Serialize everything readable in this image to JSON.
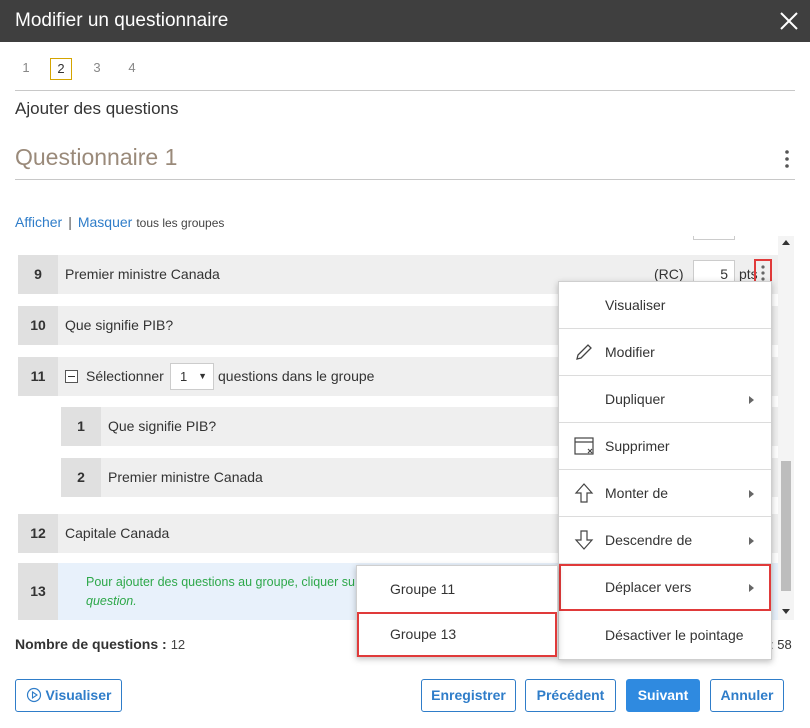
{
  "window": {
    "title": "Modifier un questionnaire"
  },
  "steps": [
    {
      "label": "1",
      "active": false
    },
    {
      "label": "2",
      "active": true
    },
    {
      "label": "3",
      "active": false
    },
    {
      "label": "4",
      "active": false
    }
  ],
  "section_title": "Ajouter des questions",
  "questionnaire_name": "Questionnaire 1",
  "group_toggle": {
    "show": "Afficher",
    "hide": "Masquer",
    "suffix": "tous les groupes"
  },
  "rows": {
    "r9": {
      "num": "9",
      "text": "Premier ministre Canada",
      "type": "(RC)",
      "points": "5",
      "points_unit": "pts"
    },
    "r10": {
      "num": "10",
      "text": "Que signifie PIB?"
    },
    "r11": {
      "num": "11",
      "select_label": "Sélectionner",
      "select_value": "1",
      "after_label": "questions dans le groupe"
    },
    "sub1": {
      "num": "1",
      "text": "Que signifie PIB?"
    },
    "sub2": {
      "num": "2",
      "text": "Premier ministre Canada"
    },
    "r12": {
      "num": "12",
      "text": "Capitale Canada"
    },
    "r13": {
      "num": "13",
      "hint": "Pour ajouter des questions au groupe, cliquer su",
      "hint_em": "question."
    }
  },
  "context_menu": {
    "items": [
      {
        "label": "Visualiser",
        "icon": "",
        "submenu": false
      },
      {
        "label": "Modifier",
        "icon": "pencil-icon",
        "submenu": false
      },
      {
        "label": "Dupliquer",
        "icon": "",
        "submenu": true
      },
      {
        "label": "Supprimer",
        "icon": "delete-window-icon",
        "submenu": false
      },
      {
        "label": "Monter de",
        "icon": "arrow-up-icon",
        "submenu": true
      },
      {
        "label": "Descendre de",
        "icon": "arrow-down-icon",
        "submenu": true
      },
      {
        "label": "Déplacer vers",
        "icon": "",
        "submenu": true,
        "highlighted": true
      },
      {
        "label": "Désactiver le pointage",
        "icon": "",
        "submenu": false
      }
    ]
  },
  "submenu": {
    "items": [
      {
        "label": "Groupe 11"
      },
      {
        "label": "Groupe 13",
        "highlighted": true
      }
    ]
  },
  "footer": {
    "count_label": "Nombre de questions :",
    "count_value": "12",
    "time_partial": ": 58"
  },
  "buttons": {
    "preview": "Visualiser",
    "save": "Enregistrer",
    "previous": "Précédent",
    "next": "Suivant",
    "cancel": "Annuler"
  },
  "colors": {
    "accent": "#2f7dc9",
    "primary_button": "#2f8ae0",
    "highlight": "#e03a3a",
    "hint_text": "#2ea84a",
    "titlebar": "#3f3f3f"
  }
}
